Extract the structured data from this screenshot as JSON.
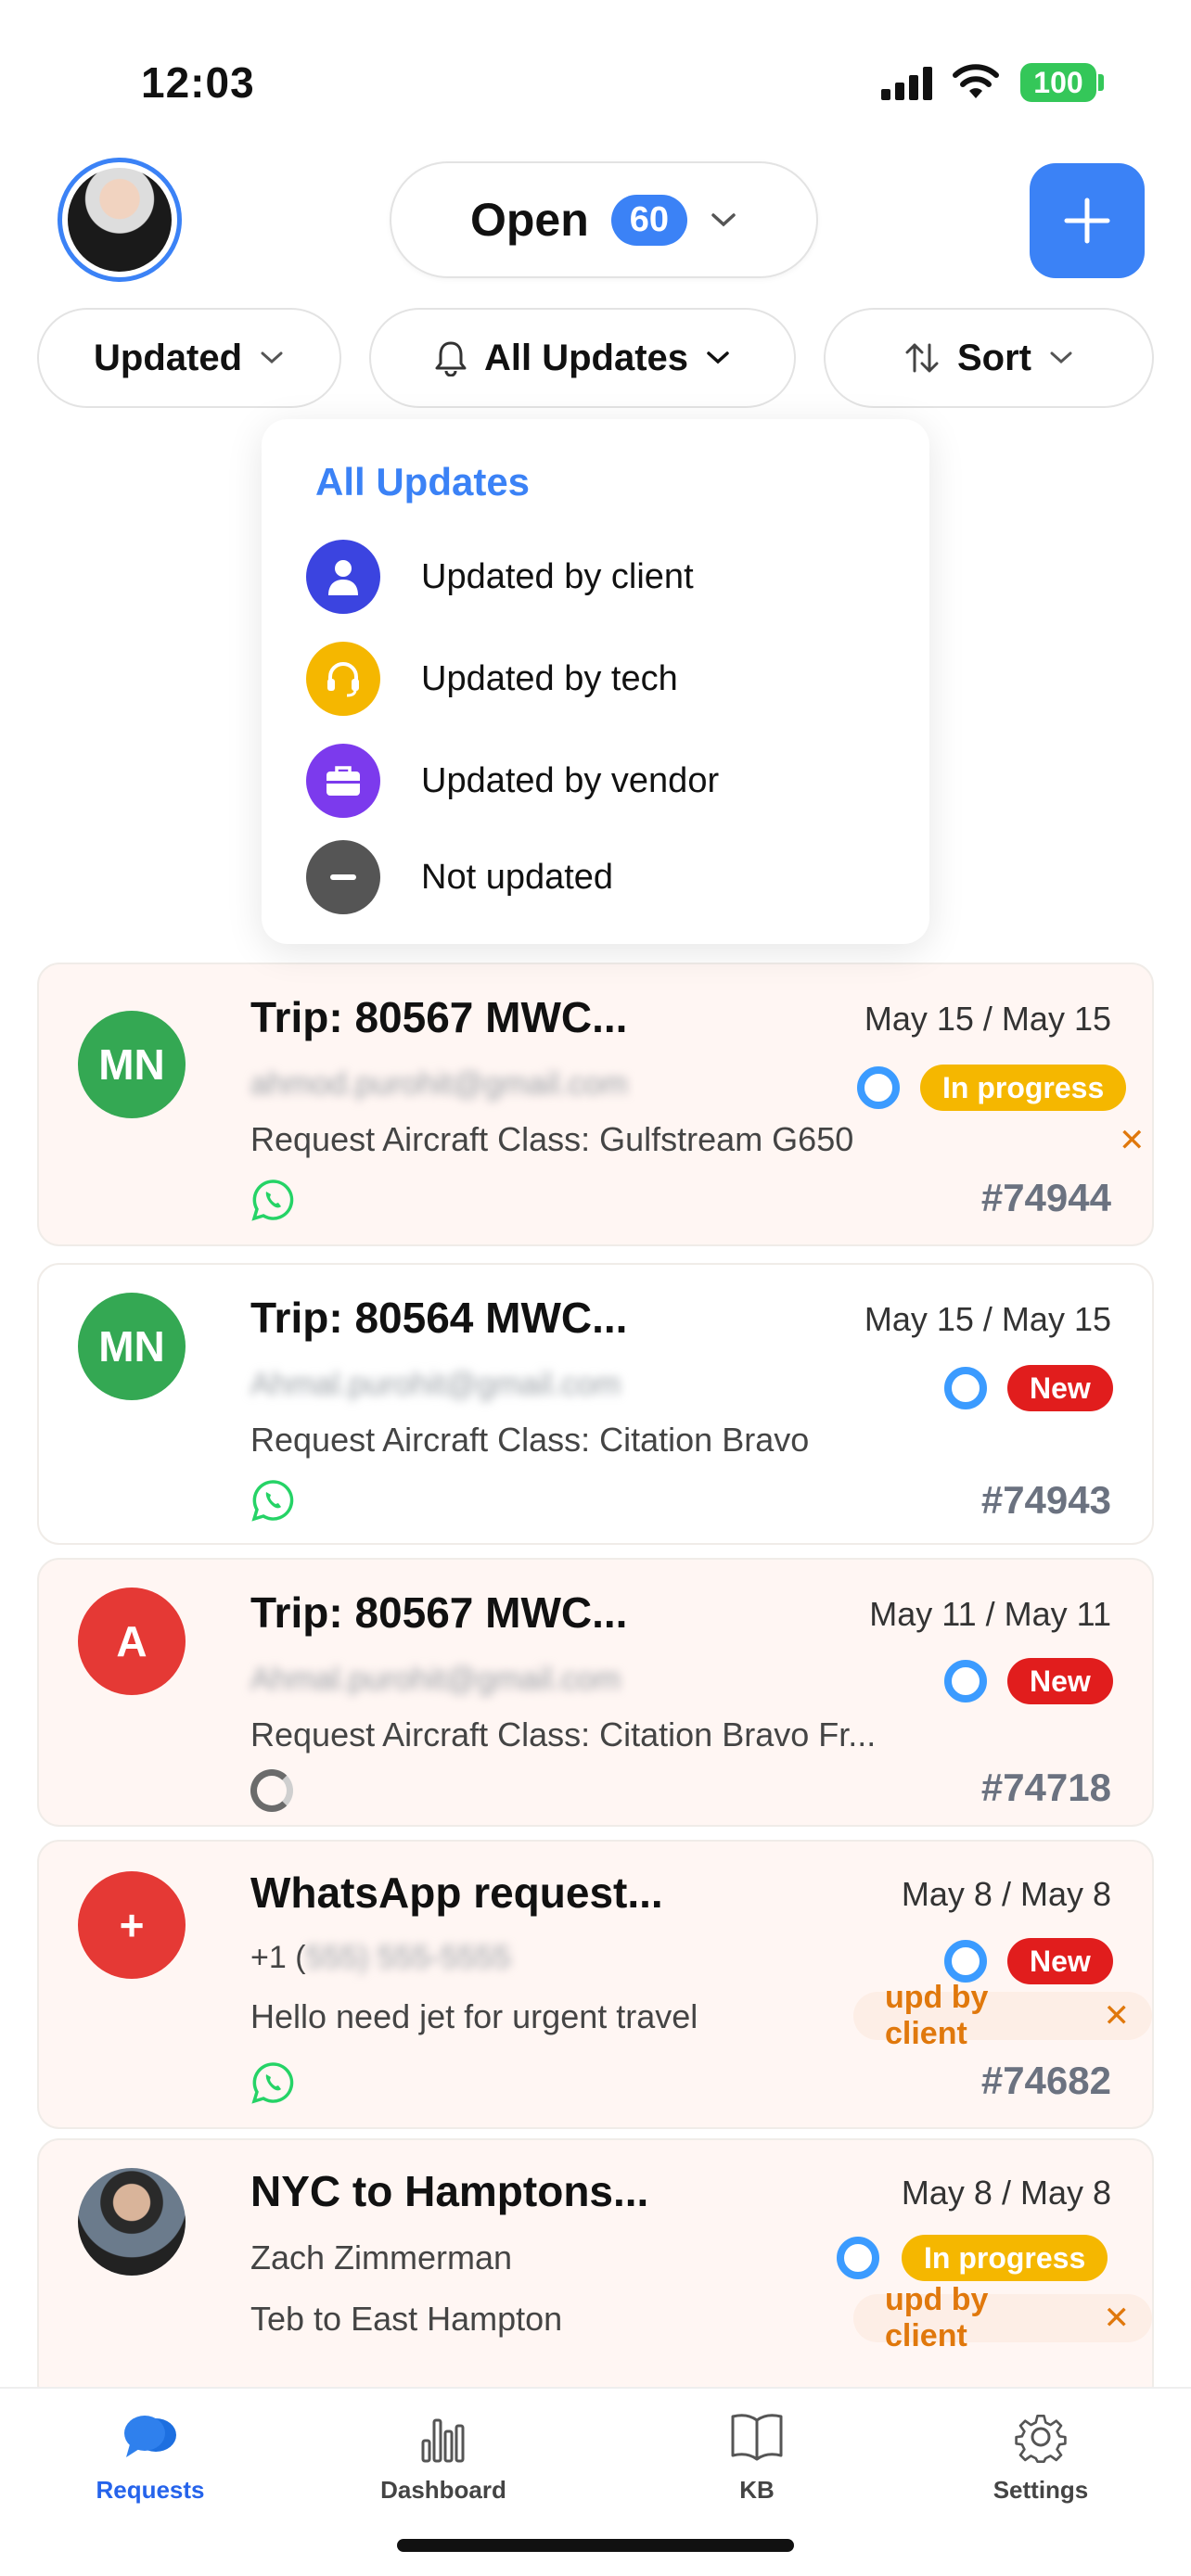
{
  "status_bar": {
    "time": "12:03",
    "battery": "100"
  },
  "header": {
    "open_label": "Open",
    "open_count": "60"
  },
  "filters": {
    "updated": "Updated",
    "all_updates": "All Updates",
    "sort": "Sort"
  },
  "dropdown": {
    "title": "All Updates",
    "items": [
      {
        "label": "Updated by client",
        "icon": "person-icon",
        "color": "#3b44e0"
      },
      {
        "label": "Updated by tech",
        "icon": "headset-icon",
        "color": "#f5b700"
      },
      {
        "label": "Updated by vendor",
        "icon": "briefcase-icon",
        "color": "#7c3aed"
      },
      {
        "label": "Not updated",
        "icon": "minus-icon",
        "color": "#555555"
      }
    ]
  },
  "requests": [
    {
      "initials": "MN",
      "avatar_color": "#34a853",
      "title": "Trip: 80567 MWC...",
      "dates": "May 15 / May 15",
      "contact": "ahmod.purohit@gmail.com",
      "description": "Request Aircraft Class: Gulfstream G650",
      "status": "In progress",
      "number": "#74944",
      "channel": "whatsapp-icon"
    },
    {
      "initials": "MN",
      "avatar_color": "#34a853",
      "title": "Trip: 80564 MWC...",
      "dates": "May 15 / May 15",
      "contact": "Ahmal.purohit@gmail.com",
      "description": "Request Aircraft Class: Citation Bravo",
      "status": "New",
      "number": "#74943",
      "channel": "whatsapp-icon"
    },
    {
      "initials": "A",
      "avatar_color": "#e53935",
      "title": "Trip: 80567 MWC...",
      "dates": "May 11 / May 11",
      "contact": "Ahmal.purohit@gmail.com",
      "description": "Request Aircraft Class: Citation Bravo Fr...",
      "status": "New",
      "number": "#74718",
      "channel": "loading-icon"
    },
    {
      "initials": "+",
      "avatar_color": "#e53935",
      "title": "WhatsApp request...",
      "dates": "May 8 / May 8",
      "contact_prefix": "+1 (",
      "contact": "555) 555-5555",
      "description": "Hello need jet for urgent travel",
      "status": "New",
      "update_tag": "upd by client",
      "number": "#74682",
      "channel": "whatsapp-icon"
    },
    {
      "initials": "",
      "avatar_color": "#3a3a3a",
      "title": "NYC to Hamptons...",
      "dates": "May 8 / May 8",
      "contact": "Zach Zimmerman",
      "description": "Teb to East Hampton",
      "status": "In progress",
      "update_tag": "upd by client"
    }
  ],
  "tabs": [
    {
      "label": "Requests",
      "icon": "chat-bubbles-icon",
      "active": true
    },
    {
      "label": "Dashboard",
      "icon": "bar-chart-icon"
    },
    {
      "label": "KB",
      "icon": "book-icon"
    },
    {
      "label": "Settings",
      "icon": "gear-icon"
    }
  ],
  "colors": {
    "accent": "#3b82f6",
    "progress": "#f5b700",
    "new": "#e11d1d",
    "update_tag": "#e0780c"
  }
}
